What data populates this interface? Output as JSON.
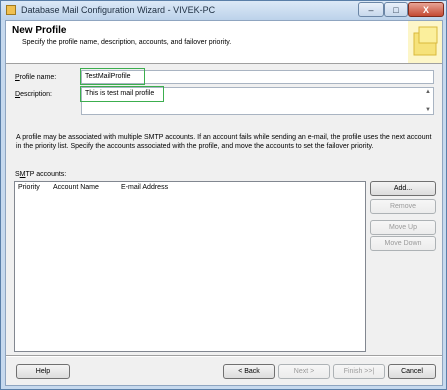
{
  "window": {
    "title": "Database Mail Configuration Wizard - VIVEK-PC",
    "minimize_glyph": "–",
    "maximize_glyph": "□",
    "close_glyph": "X"
  },
  "header": {
    "title": "New Profile",
    "subtitle": "Specify the profile name, description, accounts, and failover priority."
  },
  "form": {
    "profile_name_label": "Profile name:",
    "profile_name_value": "TestMailProfile",
    "description_label": "Description:",
    "description_value": "This is test mail profile",
    "explanation": "A profile may be associated with multiple SMTP accounts. If an account fails while sending an e-mail, the profile uses the next account in the priority list. Specify the accounts associated with the profile, and move the accounts to set the failover priority."
  },
  "smtp": {
    "label": "SMTP accounts:",
    "columns": [
      "Priority",
      "Account Name",
      "E-mail Address"
    ],
    "rows": []
  },
  "side_buttons": {
    "add": "Add...",
    "remove": "Remove",
    "move_up": "Move Up",
    "move_down": "Move Down"
  },
  "footer": {
    "help": "Help",
    "back": "< Back",
    "next": "Next >",
    "finish": "Finish >>|",
    "cancel": "Cancel"
  },
  "colors": {
    "highlight": "#3cae4e",
    "title_bar": "#c6d9ee",
    "close_button": "#c44a33"
  }
}
